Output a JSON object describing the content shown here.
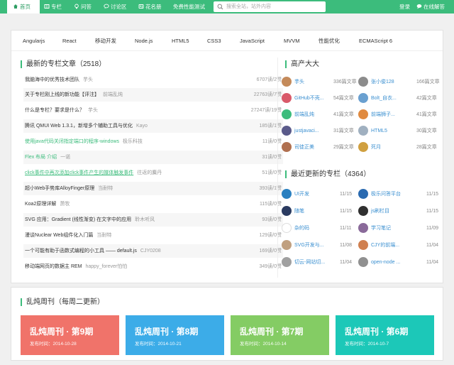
{
  "nav": {
    "items": [
      {
        "label": "首页",
        "icon": "home-icon",
        "active": true
      },
      {
        "label": "专栏",
        "icon": "book-icon"
      },
      {
        "label": "问答",
        "icon": "bulb-icon"
      },
      {
        "label": "讨论区",
        "icon": "chat-icon"
      },
      {
        "label": "花名册",
        "icon": "roster-icon"
      },
      {
        "label": "免费性能测试"
      }
    ],
    "search_placeholder": "搜索全站，站外内容",
    "login": "登录",
    "feedback": "在线解答"
  },
  "tags": [
    "Angularjs",
    "React",
    "移动开发",
    "Node.js",
    "HTML5",
    "CSS3",
    "JavaScript",
    "MVVM",
    "性能优化",
    "ECMAScript 6"
  ],
  "latest": {
    "title": "最新的专栏文章（2518）",
    "rows": [
      {
        "title": "我脑海中的优秀技术团队",
        "author": "芋头",
        "meta": "6707读/2赞"
      },
      {
        "title": "关于专栏刚上线的新功能【评注】",
        "author": "前端乱炖",
        "meta": "22763读/7赞"
      },
      {
        "title": "什么是专栏？要求是什么？",
        "author": "芋头",
        "meta": "27247读/19赞"
      },
      {
        "title": "腾讯 QMUI Web 1.3.1，新增多个辅助工具与优化",
        "author": "Kayo",
        "meta": "185读/1赞"
      },
      {
        "title": "使用java代码关闭指定端口的程序-windows",
        "author": "极乐科技",
        "meta": "11读/0赞",
        "style": "green"
      },
      {
        "title": "Flex 布局 介绍",
        "author": "一诺",
        "meta": "31读/0赞",
        "style": "green"
      },
      {
        "title": "click事件中再次添加click事件产生的媒体触发事件",
        "author": "往返的麋丹",
        "meta": "51读/0赞",
        "style": "green-under"
      },
      {
        "title": "超小Web手势库AlloyFinger原理",
        "author": "当耐特",
        "meta": "393读/1赞"
      },
      {
        "title": "Koa2原理详解",
        "author": "萧牧",
        "meta": "115读/0赞"
      },
      {
        "title": "SVG 应用：Gradient (线性渐变) 在文字中的应用",
        "author": "聆木听风",
        "meta": "93读/0赞"
      },
      {
        "title": "漫谈Nuclear Web组件化入门篇",
        "author": "当耐特",
        "meta": "129读/0赞"
      },
      {
        "title": "一个可能有助于函数式编程的小工具 —— default.js",
        "author": "CJY0208",
        "meta": "169读/0赞"
      },
      {
        "title": "移动端网页的数据主 REM",
        "author": "happy_forever怕怕",
        "meta": "349读/0赞"
      }
    ]
  },
  "prolific": {
    "title": "高产大大",
    "authors": [
      {
        "name": "芋头",
        "count": "336篇文章",
        "color": "#c48a5a"
      },
      {
        "name": "张小俊128",
        "count": "166篇文章",
        "color": "#8c8c8c"
      },
      {
        "name": "GitHub不壳...",
        "count": "54篇文章",
        "color": "#d95a6a"
      },
      {
        "name": "Bolt_自衣...",
        "count": "42篇文章",
        "color": "#6aa0d0"
      },
      {
        "name": "前端乱炖",
        "count": "41篇文章",
        "color": "#3cbc7c"
      },
      {
        "name": "前端狮子...",
        "count": "41篇文章",
        "color": "#e08a40"
      },
      {
        "name": "justjavaci...",
        "count": "31篇文章",
        "color": "#5a5a8a"
      },
      {
        "name": "HTML5",
        "count": "30篇文章",
        "color": "#a0b0c0"
      },
      {
        "name": "司徒正美",
        "count": "29篇文章",
        "color": "#b07050"
      },
      {
        "name": "死月",
        "count": "28篇文章",
        "color": "#d0a040"
      }
    ]
  },
  "columns": {
    "title": "最近更新的专栏（4364）",
    "items": [
      {
        "name": "UI开发",
        "date": "11/15",
        "color": "#2a80c0"
      },
      {
        "name": "极乐问答平台",
        "date": "11/15",
        "color": "#2a6ab0"
      },
      {
        "name": "随笔",
        "date": "11/15",
        "color": "#2a3a60"
      },
      {
        "name": "js刷栏目",
        "date": "11/15",
        "color": "#303030"
      },
      {
        "name": "杂的码",
        "date": "11/11",
        "color": "#ffffff"
      },
      {
        "name": "学习笔记",
        "date": "11/09",
        "color": "#8a6a9a"
      },
      {
        "name": "SVG开发与...",
        "date": "11/08",
        "color": "#c0a080"
      },
      {
        "name": "CJY的前端...",
        "date": "11/04",
        "color": "#d08050"
      },
      {
        "name": "切云-网站切...",
        "date": "11/04",
        "color": "#a0a0a0"
      },
      {
        "name": "open-node ...",
        "date": "11/04",
        "color": "#909090"
      }
    ]
  },
  "weekly": {
    "title": "乱炖周刊（每周二更新）",
    "cards": [
      {
        "title": "乱炖周刊 · 第9期",
        "date": "发布时间：2014-10-28",
        "color": "#f0736a"
      },
      {
        "title": "乱炖周刊 · 第8期",
        "date": "发布时间：2014-10-21",
        "color": "#3cace8"
      },
      {
        "title": "乱炖周刊 · 第7期",
        "date": "发布时间：2014-10-14",
        "color": "#84cc64"
      },
      {
        "title": "乱炖周刊 · 第6期",
        "date": "发布时间：2014-10-7",
        "color": "#1cc8b8"
      }
    ]
  }
}
